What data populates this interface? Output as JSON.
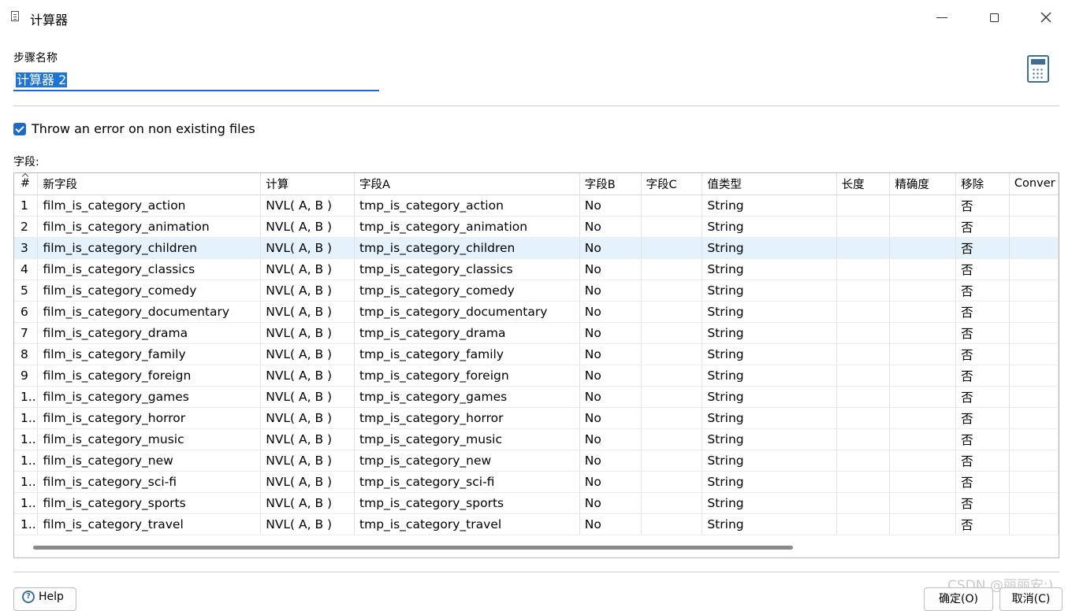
{
  "window": {
    "title": "计算器",
    "icon": "document-icon"
  },
  "step": {
    "label": "步骤名称",
    "value": "计算器 2"
  },
  "options": {
    "throw_error_label": "Throw an error on non existing files",
    "throw_error_checked": true
  },
  "fields_label": "字段:",
  "table": {
    "columns": [
      "#",
      "新字段",
      "计算",
      "字段A",
      "字段B",
      "字段C",
      "值类型",
      "长度",
      "精确度",
      "移除",
      "Conver"
    ],
    "selected_row": 2,
    "rows": [
      {
        "num": "1",
        "new_field": "film_is_category_action",
        "calc": "NVL( A, B )",
        "field_a": "tmp_is_category_action",
        "field_b": "No",
        "field_c": "",
        "type": "String",
        "length": "",
        "precision": "",
        "remove": "否",
        "convert": ""
      },
      {
        "num": "2",
        "new_field": "film_is_category_animation",
        "calc": "NVL( A, B )",
        "field_a": "tmp_is_category_animation",
        "field_b": "No",
        "field_c": "",
        "type": "String",
        "length": "",
        "precision": "",
        "remove": "否",
        "convert": ""
      },
      {
        "num": "3",
        "new_field": "film_is_category_children",
        "calc": "NVL( A, B )",
        "field_a": "tmp_is_category_children",
        "field_b": "No",
        "field_c": "",
        "type": "String",
        "length": "",
        "precision": "",
        "remove": "否",
        "convert": ""
      },
      {
        "num": "4",
        "new_field": "film_is_category_classics",
        "calc": "NVL( A, B )",
        "field_a": "tmp_is_category_classics",
        "field_b": "No",
        "field_c": "",
        "type": "String",
        "length": "",
        "precision": "",
        "remove": "否",
        "convert": ""
      },
      {
        "num": "5",
        "new_field": "film_is_category_comedy",
        "calc": "NVL( A, B )",
        "field_a": "tmp_is_category_comedy",
        "field_b": "No",
        "field_c": "",
        "type": "String",
        "length": "",
        "precision": "",
        "remove": "否",
        "convert": ""
      },
      {
        "num": "6",
        "new_field": "film_is_category_documentary",
        "calc": "NVL( A, B )",
        "field_a": "tmp_is_category_documentary",
        "field_b": "No",
        "field_c": "",
        "type": "String",
        "length": "",
        "precision": "",
        "remove": "否",
        "convert": ""
      },
      {
        "num": "7",
        "new_field": "film_is_category_drama",
        "calc": "NVL( A, B )",
        "field_a": "tmp_is_category_drama",
        "field_b": "No",
        "field_c": "",
        "type": "String",
        "length": "",
        "precision": "",
        "remove": "否",
        "convert": ""
      },
      {
        "num": "8",
        "new_field": "film_is_category_family",
        "calc": "NVL( A, B )",
        "field_a": "tmp_is_category_family",
        "field_b": "No",
        "field_c": "",
        "type": "String",
        "length": "",
        "precision": "",
        "remove": "否",
        "convert": ""
      },
      {
        "num": "9",
        "new_field": "film_is_category_foreign",
        "calc": "NVL( A, B )",
        "field_a": "tmp_is_category_foreign",
        "field_b": "No",
        "field_c": "",
        "type": "String",
        "length": "",
        "precision": "",
        "remove": "否",
        "convert": ""
      },
      {
        "num": "1..",
        "new_field": "film_is_category_games",
        "calc": "NVL( A, B )",
        "field_a": "tmp_is_category_games",
        "field_b": "No",
        "field_c": "",
        "type": "String",
        "length": "",
        "precision": "",
        "remove": "否",
        "convert": ""
      },
      {
        "num": "1..",
        "new_field": "film_is_category_horror",
        "calc": "NVL( A, B )",
        "field_a": "tmp_is_category_horror",
        "field_b": "No",
        "field_c": "",
        "type": "String",
        "length": "",
        "precision": "",
        "remove": "否",
        "convert": ""
      },
      {
        "num": "1..",
        "new_field": "film_is_category_music",
        "calc": "NVL( A, B )",
        "field_a": "tmp_is_category_music",
        "field_b": "No",
        "field_c": "",
        "type": "String",
        "length": "",
        "precision": "",
        "remove": "否",
        "convert": ""
      },
      {
        "num": "1..",
        "new_field": "film_is_category_new",
        "calc": "NVL( A, B )",
        "field_a": "tmp_is_category_new",
        "field_b": "No",
        "field_c": "",
        "type": "String",
        "length": "",
        "precision": "",
        "remove": "否",
        "convert": ""
      },
      {
        "num": "1..",
        "new_field": "film_is_category_sci-fi",
        "calc": "NVL( A, B )",
        "field_a": "tmp_is_category_sci-fi",
        "field_b": "No",
        "field_c": "",
        "type": "String",
        "length": "",
        "precision": "",
        "remove": "否",
        "convert": ""
      },
      {
        "num": "1..",
        "new_field": "film_is_category_sports",
        "calc": "NVL( A, B )",
        "field_a": "tmp_is_category_sports",
        "field_b": "No",
        "field_c": "",
        "type": "String",
        "length": "",
        "precision": "",
        "remove": "否",
        "convert": ""
      },
      {
        "num": "1..",
        "new_field": "film_is_category_travel",
        "calc": "NVL( A, B )",
        "field_a": "tmp_is_category_travel",
        "field_b": "No",
        "field_c": "",
        "type": "String",
        "length": "",
        "precision": "",
        "remove": "否",
        "convert": ""
      }
    ]
  },
  "icons": {
    "calculator": "calculator-icon",
    "help": "help-icon",
    "minimize": "minimize-icon",
    "maximize": "maximize-icon",
    "close": "close-icon"
  },
  "buttons": {
    "help": "Help",
    "ok": "确定(O)",
    "cancel": "取消(C)"
  },
  "watermark": "CSDN @丽丽安:)",
  "colors": {
    "accent": "#1e6ac6",
    "selected_row": "#e5f1fb",
    "icon": "#3d6f95"
  }
}
